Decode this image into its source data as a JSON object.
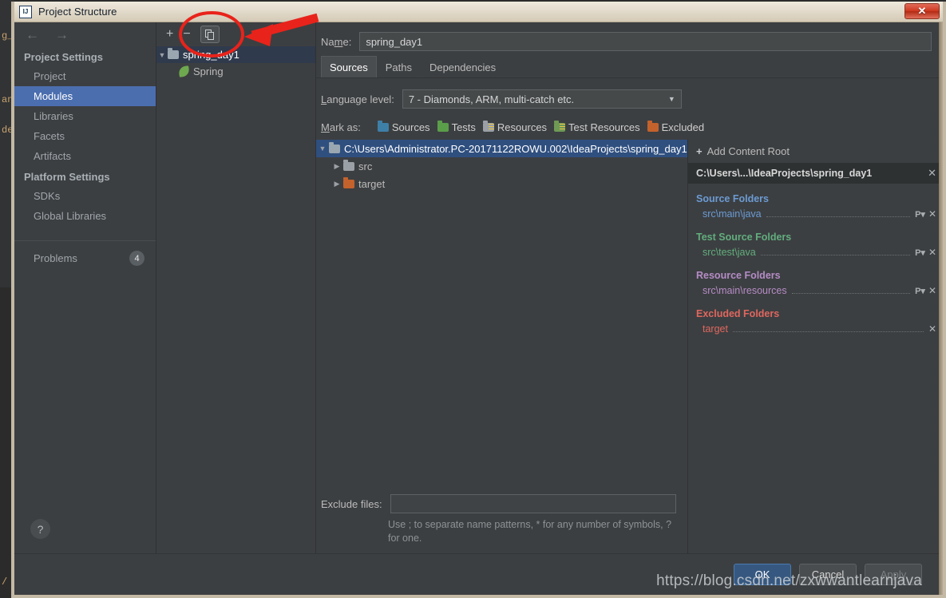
{
  "window": {
    "title": "Project Structure",
    "app_icon": "intellij-idea-icon",
    "close_label": "✕"
  },
  "ide_background": {
    "fragments": [
      "g_",
      "an",
      "de",
      "/ c"
    ]
  },
  "sidebar": {
    "nav": {
      "back": "←",
      "forward": "→"
    },
    "groups": [
      {
        "title": "Project Settings",
        "items": [
          {
            "label": "Project",
            "selected": false
          },
          {
            "label": "Modules",
            "selected": true
          },
          {
            "label": "Libraries",
            "selected": false
          },
          {
            "label": "Facets",
            "selected": false
          },
          {
            "label": "Artifacts",
            "selected": false
          }
        ]
      },
      {
        "title": "Platform Settings",
        "items": [
          {
            "label": "SDKs",
            "selected": false
          },
          {
            "label": "Global Libraries",
            "selected": false
          }
        ]
      }
    ],
    "problems": {
      "label": "Problems",
      "count": "4"
    },
    "help_label": "?"
  },
  "module_panel": {
    "toolbar": {
      "add": "+",
      "remove": "−",
      "copy": "❐"
    },
    "tree": [
      {
        "label": "spring_day1",
        "type": "module",
        "selected": true,
        "expander": "▼",
        "icon_color": "#9aa7b0"
      },
      {
        "label": "Spring",
        "type": "facet",
        "selected": false,
        "expander": "",
        "icon_color": "#6ea84f"
      }
    ]
  },
  "main": {
    "name_label": "Na̲me:",
    "name_value": "spring_day1",
    "tabs": [
      {
        "label": "Sources",
        "active": true
      },
      {
        "label": "Paths",
        "active": false
      },
      {
        "label": "Dependencies",
        "active": false
      }
    ],
    "language_level_label": "Language level:",
    "language_level_value": "7 - Diamonds, ARM, multi-catch etc.",
    "language_level_caret": "▼",
    "mark_as_label": "Mark as:",
    "mark_as": [
      {
        "label": "Sources",
        "color": "#3e7fa8",
        "lines": false
      },
      {
        "label": "Tests",
        "color": "#5b9e4a",
        "lines": false
      },
      {
        "label": "Resources",
        "color": "#9aa0a6",
        "lines": true
      },
      {
        "label": "Test Resources",
        "color": "#6f9a55",
        "lines": true
      },
      {
        "label": "Excluded",
        "color": "#c4622d",
        "lines": false
      }
    ],
    "roots_tree": [
      {
        "label": "C:\\Users\\Administrator.PC-20171122ROWU.002\\IdeaProjects\\spring_day1",
        "expander": "▼",
        "indent": 0,
        "selected": true,
        "color": "#9aa7b0"
      },
      {
        "label": "src",
        "expander": "▶",
        "indent": 1,
        "selected": false,
        "color": "#9aa0a6"
      },
      {
        "label": "target",
        "expander": "▶",
        "indent": 1,
        "selected": false,
        "color": "#c4622d"
      }
    ],
    "exclude_files_label": "Exclude files:",
    "exclude_files_value": "",
    "exclude_hint": "Use ; to separate name patterns, * for any number of symbols, ? for one."
  },
  "detail_panel": {
    "add_content_root": "Add Content Root",
    "add_icon": "+",
    "content_root": "C:\\Users\\...\\IdeaProjects\\spring_day1",
    "content_root_remove": "✕",
    "groups": [
      {
        "title": "Source Folders",
        "color": "#6c9bd4",
        "rows": [
          {
            "path": "src\\main\\java",
            "prefix_icon": "P▾",
            "remove_icon": "✕"
          }
        ]
      },
      {
        "title": "Test Source Folders",
        "color": "#62ad7e",
        "rows": [
          {
            "path": "src\\test\\java",
            "prefix_icon": "P▾",
            "remove_icon": "✕"
          }
        ]
      },
      {
        "title": "Resource Folders",
        "color": "#b58cc6",
        "rows": [
          {
            "path": "src\\main\\resources",
            "prefix_icon": "P▾",
            "remove_icon": "✕"
          }
        ]
      },
      {
        "title": "Excluded Folders",
        "color": "#e0675f",
        "rows": [
          {
            "path": "target",
            "prefix_icon": "",
            "remove_icon": "✕"
          }
        ]
      }
    ]
  },
  "footer": {
    "ok": "OK",
    "cancel": "Cancel",
    "apply": "Apply"
  },
  "watermark": "https://blog.csdn.net/zxwwantlearnjava",
  "annotation": {
    "type": "red-ellipse-with-arrow",
    "target": "copy-module-button",
    "color": "#e8231b"
  }
}
